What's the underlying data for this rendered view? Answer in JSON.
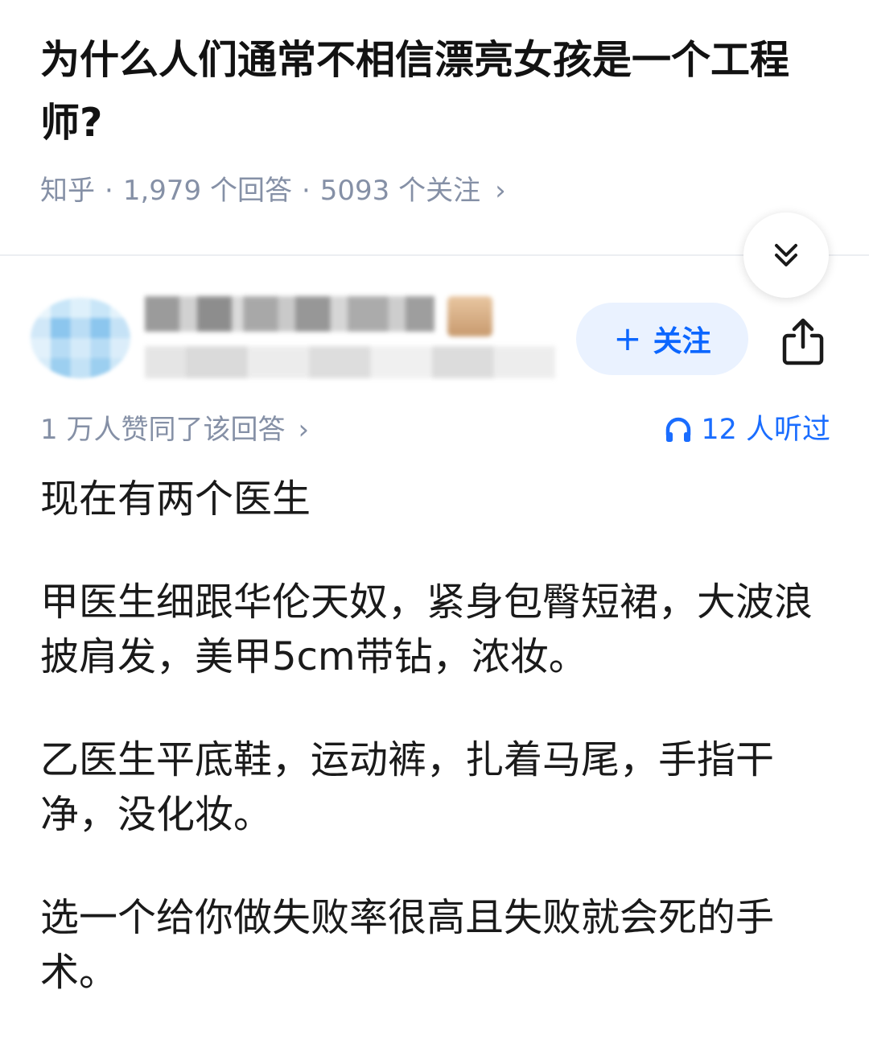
{
  "question": {
    "title": "为什么人们通常不相信漂亮女孩是一个工程师?",
    "source": "知乎",
    "separator": "·",
    "answer_count": "1,979 个回答",
    "follower_count": "5093 个关注",
    "meta_chevron": "›"
  },
  "actions": {
    "collapse_icon": "double-chevron-down-icon",
    "follow_label": "关注",
    "follow_plus": "+",
    "share_icon": "share-icon",
    "follow_color": "#0b66ff"
  },
  "answer": {
    "upvote_summary": "1 万人赞同了该回答",
    "upvote_chevron": "›",
    "listen_count": "12 人听过",
    "listen_color": "#1a6dff",
    "paragraphs": [
      "现在有两个医生",
      "甲医生细跟华伦天奴，紧身包臀短裙，大波浪披肩发，美甲5cm带钻，浓妆。",
      "乙医生平底鞋，运动裤，扎着马尾，手指干净，没化妆。",
      "选一个给你做失败率很高且失败就会死的手术。"
    ]
  }
}
